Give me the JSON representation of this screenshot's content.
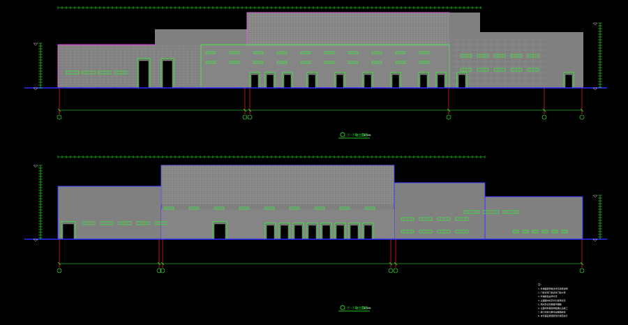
{
  "drawing": {
    "background": "#000000",
    "colors": {
      "wall": "#808080",
      "wall_dark": "#6e6e6e",
      "outline_green": "#33ff33",
      "outline_magenta": "#ff33ff",
      "outline_blue": "#3333ff",
      "axis_red": "#ff2222",
      "ground_blue": "#2a2aff",
      "white": "#ffffff",
      "grid_line": "#a9a9a9"
    },
    "elevation_1": {
      "title": "①-⑦轴立面图",
      "scale": "1:100"
    },
    "elevation_2": {
      "title": "⑦-①轴立面图",
      "scale": "1:100"
    },
    "notes_heading": "注：",
    "notes": [
      "1.外墙面装饰做法详见建施说明",
      "2.门窗详见门窗表及门窗大样",
      "3.外墙颜色由甲方定",
      "4.立面图中标高均为建筑标高",
      "5.雨水管详见屋面平面图",
      "6.立面材料需经样板确认后施工",
      "7.施工时应与各专业图纸配合",
      "8.未尽事宜按国家现行规范执行"
    ]
  }
}
